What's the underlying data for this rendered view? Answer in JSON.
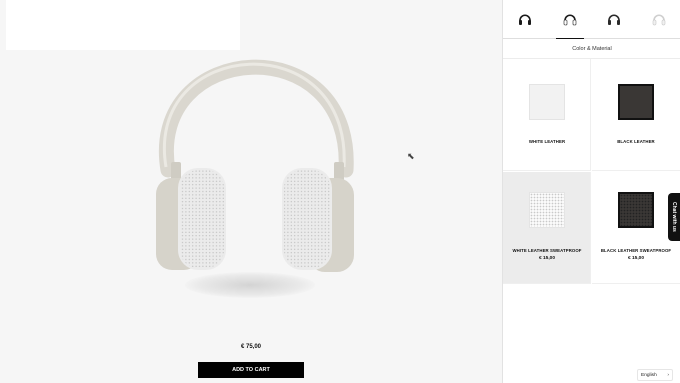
{
  "product": {
    "price": "€ 75,00",
    "add_to_cart_label": "ADD TO CART"
  },
  "variants": [
    {
      "name": "headphones-variant-1",
      "active": false
    },
    {
      "name": "headphones-variant-2",
      "active": true
    },
    {
      "name": "headphones-variant-3",
      "active": false
    },
    {
      "name": "headphones-variant-4",
      "active": false
    }
  ],
  "materials": {
    "title": "Color & Material",
    "options": [
      {
        "label": "WHITE LEATHER",
        "price": "",
        "finish": "white",
        "selected": false
      },
      {
        "label": "BLACK LEATHER",
        "price": "",
        "finish": "black",
        "selected": false
      },
      {
        "label": "WHITE LEATHER SWEATPROOF",
        "price": "€ 15,00",
        "finish": "white-perforated",
        "selected": true
      },
      {
        "label": "BLACK LEATHER SWEATPROOF",
        "price": "€ 15,00",
        "finish": "black-perforated",
        "selected": false
      }
    ]
  },
  "chat": {
    "label": "Chat with us"
  },
  "language": {
    "current": "English",
    "chevron": "›"
  },
  "colors": {
    "headband": "#dad7cf",
    "cushion": "#f3f3f3",
    "button": "#000000",
    "panel": "#ffffff"
  }
}
